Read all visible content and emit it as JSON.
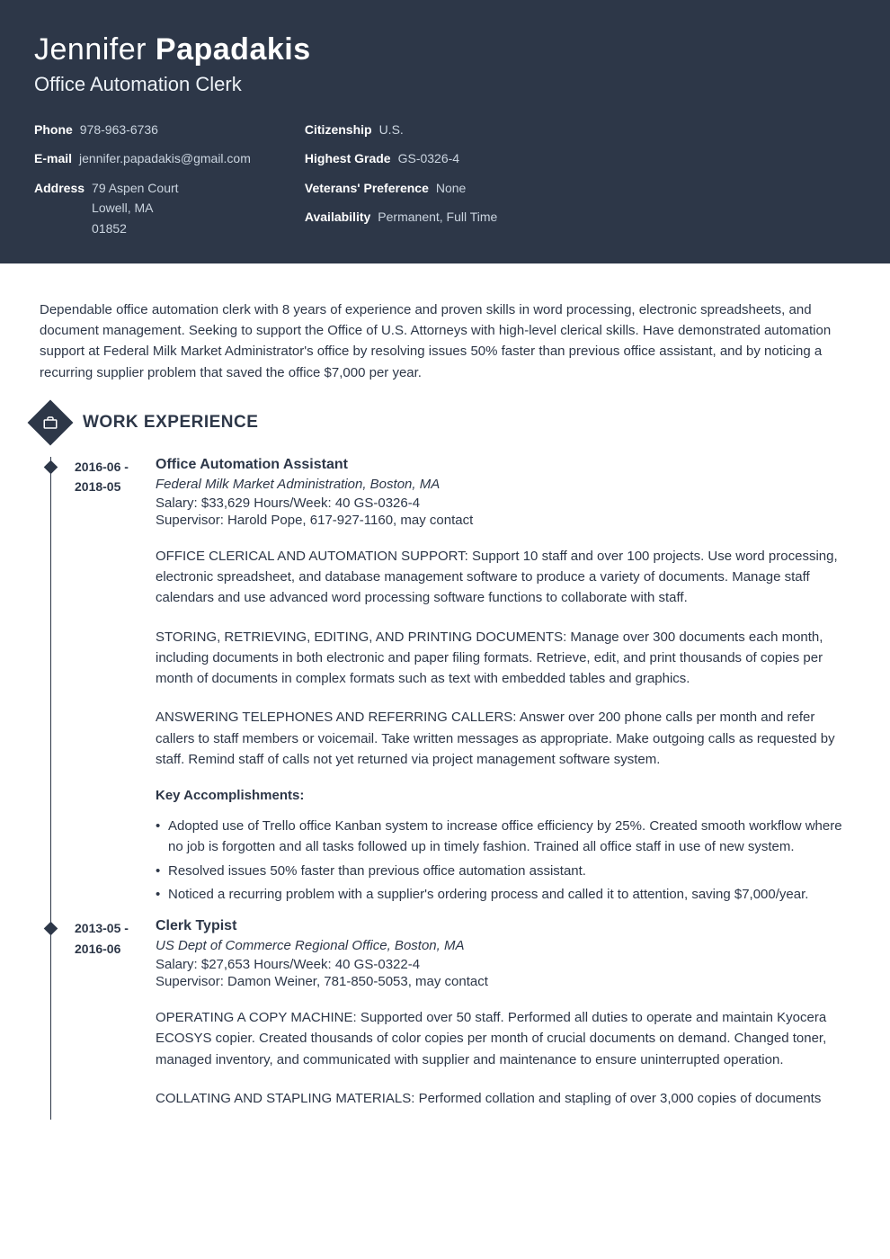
{
  "header": {
    "first_name": "Jennifer",
    "last_name": "Papadakis",
    "title": "Office Automation Clerk",
    "left": [
      {
        "label": "Phone",
        "value": "978-963-6736"
      },
      {
        "label": "E-mail",
        "value": "jennifer.papadakis@gmail.com"
      },
      {
        "label": "Address",
        "value": "79 Aspen Court\nLowell, MA\n01852"
      }
    ],
    "right": [
      {
        "label": "Citizenship",
        "value": "U.S."
      },
      {
        "label": "Highest Grade",
        "value": "GS-0326-4"
      },
      {
        "label": "Veterans' Preference",
        "value": "None"
      },
      {
        "label": "Availability",
        "value": "Permanent, Full Time"
      }
    ]
  },
  "summary": "Dependable office automation clerk with 8 years of experience and proven skills in word processing, electronic spreadsheets, and document management. Seeking to support the Office of U.S. Attorneys with high-level clerical skills. Have demonstrated automation support at Federal Milk Market Administrator's office by resolving issues 50% faster than previous office assistant, and by noticing a recurring supplier problem that saved the office $7,000 per year.",
  "sections": {
    "work_experience": {
      "title": "WORK EXPERIENCE",
      "jobs": [
        {
          "dates": "2016-06 - 2018-05",
          "title": "Office Automation Assistant",
          "org": "Federal Milk Market Administration, Boston, MA",
          "salary_line": "Salary: $33,629  Hours/Week: 40  GS-0326-4",
          "supervisor": "Supervisor: Harold Pope, 617-927-1160, may contact",
          "paras": [
            "OFFICE CLERICAL AND AUTOMATION SUPPORT: Support 10 staff and over 100 projects. Use word processing, electronic spreadsheet, and database management software to produce a variety of documents. Manage staff calendars and use advanced word processing software functions to collaborate with staff.",
            "STORING, RETRIEVING, EDITING, AND PRINTING DOCUMENTS: Manage over 300 documents each month, including documents in both electronic and paper filing formats. Retrieve, edit, and print thousands of copies per month of documents in complex formats such as text with embedded tables and graphics.",
            "ANSWERING TELEPHONES AND REFERRING CALLERS: Answer over 200 phone calls per month and refer callers to staff members or voicemail. Take written messages as appropriate. Make outgoing calls as requested by staff. Remind staff of calls not yet returned via project management software system."
          ],
          "accomp_title": "Key Accomplishments:",
          "accomp": [
            "Adopted use of Trello office Kanban system to increase office efficiency by 25%. Created smooth workflow where no job is forgotten and all tasks followed up in timely fashion. Trained all office staff in use of new system.",
            "Resolved issues 50% faster than previous office automation assistant.",
            "Noticed a recurring problem with a supplier's ordering process and called it to attention, saving $7,000/year."
          ]
        },
        {
          "dates": "2013-05 - 2016-06",
          "title": "Clerk Typist",
          "org": "US Dept of Commerce Regional Office, Boston, MA",
          "salary_line": "Salary: $27,653  Hours/Week: 40  GS-0322-4",
          "supervisor": "Supervisor: Damon Weiner, 781-850-5053, may contact",
          "paras": [
            "OPERATING A COPY MACHINE: Supported over 50 staff. Performed all duties to operate and maintain Kyocera ECOSYS copier. Created thousands of color copies per month of crucial documents on demand. Changed toner, managed inventory, and communicated with supplier and maintenance to ensure uninterrupted operation.",
            "COLLATING AND STAPLING MATERIALS: Performed collation and stapling of over 3,000 copies of documents"
          ],
          "accomp_title": "",
          "accomp": []
        }
      ]
    }
  }
}
